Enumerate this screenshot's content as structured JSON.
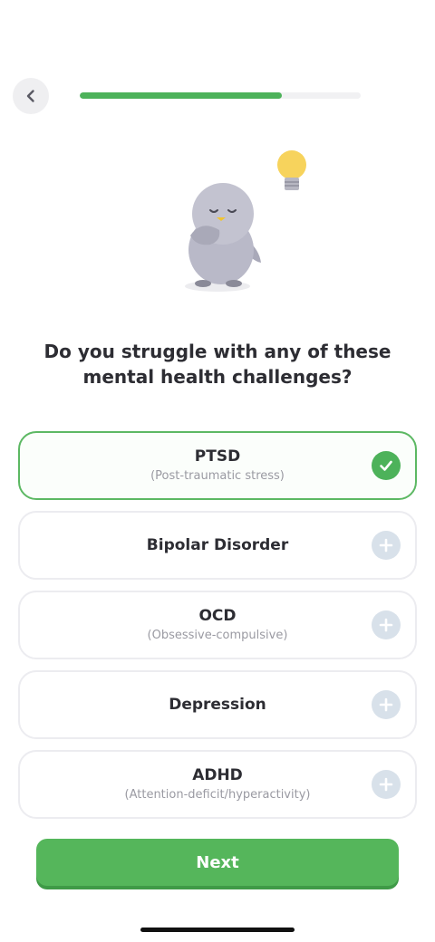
{
  "header": {
    "back_icon": "chevron-left-icon",
    "progress": 0.72
  },
  "question": {
    "line1": "Do you struggle with any of these",
    "line2": "mental health challenges?"
  },
  "options": [
    {
      "label": "PTSD",
      "sub": "(Post-traumatic stress)",
      "selected": true,
      "icon": "check-icon"
    },
    {
      "label": "Bipolar Disorder",
      "sub": "",
      "selected": false,
      "icon": "plus-icon"
    },
    {
      "label": "OCD",
      "sub": "(Obsessive-compulsive)",
      "selected": false,
      "icon": "plus-icon"
    },
    {
      "label": "Depression",
      "sub": "",
      "selected": false,
      "icon": "plus-icon"
    },
    {
      "label": "ADHD",
      "sub": "(Attention-deficit/hyperactivity)",
      "selected": false,
      "icon": "plus-icon"
    }
  ],
  "next_button": {
    "label": "Next"
  },
  "colors": {
    "accent": "#4db25a",
    "selected_border": "#5cb863",
    "plus_bg": "#d8e1ea"
  }
}
